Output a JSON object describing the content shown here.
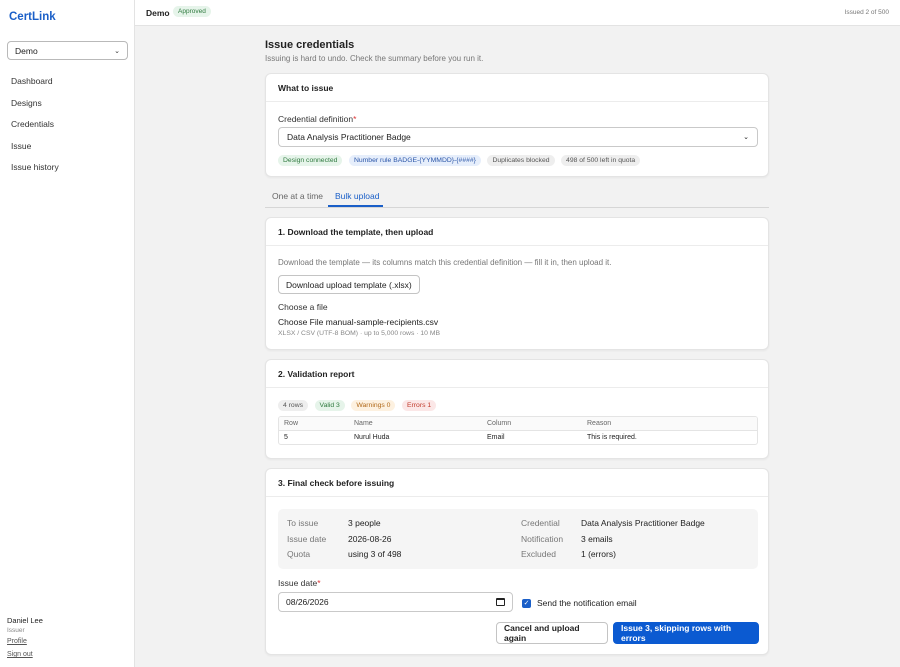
{
  "app": {
    "brand": "CertLink"
  },
  "sidebar": {
    "workspace_selected": "Demo",
    "nav": [
      {
        "label": "Dashboard"
      },
      {
        "label": "Designs"
      },
      {
        "label": "Credentials"
      },
      {
        "label": "Issue"
      },
      {
        "label": "Issue history"
      }
    ],
    "user": {
      "name": "Daniel Lee",
      "role": "Issuer",
      "profile_link": "Profile",
      "signout_link": "Sign out"
    }
  },
  "topbar": {
    "org_name": "Demo",
    "status_badge": "Approved",
    "issued_counter": "Issued 2 of 500"
  },
  "page": {
    "title": "Issue credentials",
    "subtitle": "Issuing is hard to undo. Check the summary before you run it."
  },
  "what_to_issue": {
    "heading": "What to issue",
    "field_label": "Credential definition",
    "required_mark": "*",
    "selected": "Data Analysis Practitioner Badge",
    "pills": [
      "Design connected",
      "Number rule BADGE-{YYMMDD}-{####}",
      "Duplicates blocked",
      "498 of 500 left in quota"
    ]
  },
  "tabs": [
    {
      "label": "One at a time",
      "active": false
    },
    {
      "label": "Bulk upload",
      "active": true
    }
  ],
  "step1": {
    "heading": "1. Download the template, then upload",
    "description": "Download the template — its columns match this credential definition — fill it in, then upload it.",
    "download_button": "Download upload template (.xlsx)",
    "file_label": "Choose a file",
    "file_button": "Choose File",
    "file_name": "manual-sample-recipients.csv",
    "file_hint": "XLSX / CSV (UTF-8 BOM) · up to 5,000 rows · 10 MB"
  },
  "step2": {
    "heading": "2. Validation report",
    "counts": [
      "4 rows",
      "Valid 3",
      "Warnings 0",
      "Errors 1"
    ],
    "columns": [
      "Row",
      "Name",
      "Column",
      "Reason"
    ],
    "rows": [
      {
        "row": "5",
        "name": "Nurul Huda",
        "column": "Email",
        "reason": "This is required."
      }
    ]
  },
  "step3": {
    "heading": "3. Final check before issuing",
    "summary": {
      "to_issue_label": "To issue",
      "to_issue_value": "3 people",
      "issue_date_label": "Issue date",
      "issue_date_value": "2026-08-26",
      "quota_label": "Quota",
      "quota_value": "using 3 of 498",
      "credential_label": "Credential",
      "credential_value": "Data Analysis Practitioner Badge",
      "notification_label": "Notification",
      "notification_value": "3 emails",
      "excluded_label": "Excluded",
      "excluded_value": "1 (errors)"
    },
    "date_field_label": "Issue date",
    "date_value": "08/26/2026",
    "notify_checkbox_label": "Send the notification email",
    "notify_checked": true,
    "cancel_button": "Cancel and upload again",
    "issue_button": "Issue 3, skipping rows with errors"
  },
  "colors": {
    "accent": "#1a5fc8",
    "primary_button": "#0b5ad1",
    "error": "#c0392b",
    "success": "#2f7a3f"
  },
  "icons": {
    "select_chevron": "chevron-down-icon",
    "calendar": "calendar-icon",
    "checkbox": "check-icon"
  }
}
